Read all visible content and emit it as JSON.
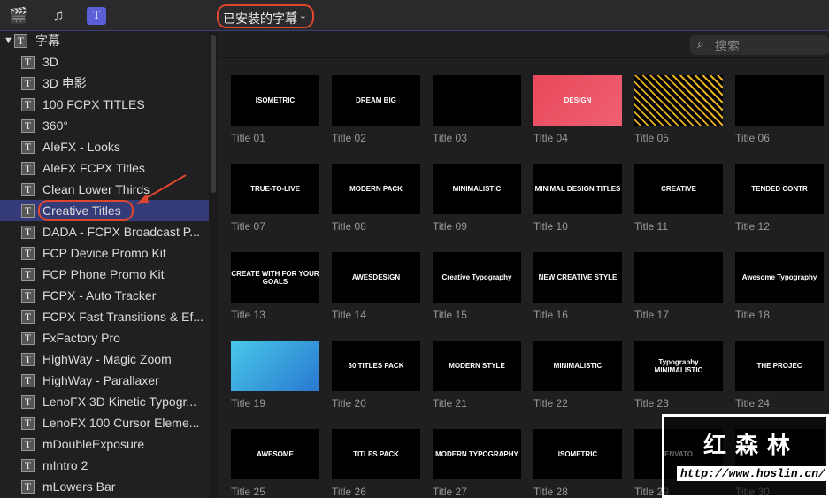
{
  "toolbar": {
    "icons": [
      "clapper-star-icon",
      "music-photo-icon",
      "titles-icon"
    ],
    "selector": "已安装的字幕"
  },
  "search": {
    "placeholder": "搜索"
  },
  "sidebar": {
    "root": "字幕",
    "items": [
      "3D",
      "3D 电影",
      "100 FCPX TITLES",
      "360°",
      "AleFX - Looks",
      "AleFX FCPX Titles",
      "Clean Lower Thirds",
      "Creative Titles",
      "DADA - FCPX Broadcast P...",
      "FCP Device Promo Kit",
      "FCP Phone Promo Kit",
      "FCPX - Auto Tracker",
      "FCPX Fast Transitions & Ef...",
      "FxFactory Pro",
      "HighWay - Magic Zoom",
      "HighWay - Parallaxer",
      "LenoFX 3D Kinetic Typogr...",
      "LenoFX 100 Cursor Eleme...",
      "mDoubleExposure",
      "mIntro 2",
      "mLowers Bar"
    ],
    "selected_index": 7
  },
  "grid": {
    "titles": [
      {
        "label": "Title 01",
        "text": "ISOMETRIC"
      },
      {
        "label": "Title 02",
        "text": "DREAM BIG"
      },
      {
        "label": "Title 03",
        "text": ""
      },
      {
        "label": "Title 04",
        "text": "DESIGN"
      },
      {
        "label": "Title 05",
        "text": ""
      },
      {
        "label": "Title 06",
        "text": ""
      },
      {
        "label": "Title 07",
        "text": "TRUE-TO-LIVE"
      },
      {
        "label": "Title 08",
        "text": "MODERN PACK"
      },
      {
        "label": "Title 09",
        "text": "MINIMALISTIC"
      },
      {
        "label": "Title 10",
        "text": "MINIMAL DESIGN TITLES"
      },
      {
        "label": "Title 11",
        "text": "CREATIVE"
      },
      {
        "label": "Title 12",
        "text": "TENDED CONTR"
      },
      {
        "label": "Title 13",
        "text": "CREATE WITH FOR YOUR GOALS"
      },
      {
        "label": "Title 14",
        "text": "AWESDESIGN"
      },
      {
        "label": "Title 15",
        "text": "Creative Typography"
      },
      {
        "label": "Title 16",
        "text": "NEW CREATIVE STYLE"
      },
      {
        "label": "Title 17",
        "text": ""
      },
      {
        "label": "Title 18",
        "text": "Awesome Typography"
      },
      {
        "label": "Title 19",
        "text": ""
      },
      {
        "label": "Title 20",
        "text": "30 TITLES PACK"
      },
      {
        "label": "Title 21",
        "text": "MODERN STYLE"
      },
      {
        "label": "Title 22",
        "text": "MINIMALISTIC"
      },
      {
        "label": "Title 23",
        "text": "Typography MINIMALISTIC"
      },
      {
        "label": "Title 24",
        "text": "THE PROJEC"
      },
      {
        "label": "Title 25",
        "text": "AWESOME"
      },
      {
        "label": "Title 26",
        "text": "TITLES PACK"
      },
      {
        "label": "Title 27",
        "text": "MODERN TYPOGRAPHY"
      },
      {
        "label": "Title 28",
        "text": "ISOMETRIC"
      },
      {
        "label": "Title 29",
        "text": "ENVATO"
      },
      {
        "label": "Title 30",
        "text": ""
      }
    ]
  },
  "watermark": {
    "name": "红森林",
    "url": "http://www.hoslin.cn/"
  },
  "colors": {
    "selection": "#353a78",
    "highlight": "#e0452e",
    "accent": "#5a5fd6"
  }
}
